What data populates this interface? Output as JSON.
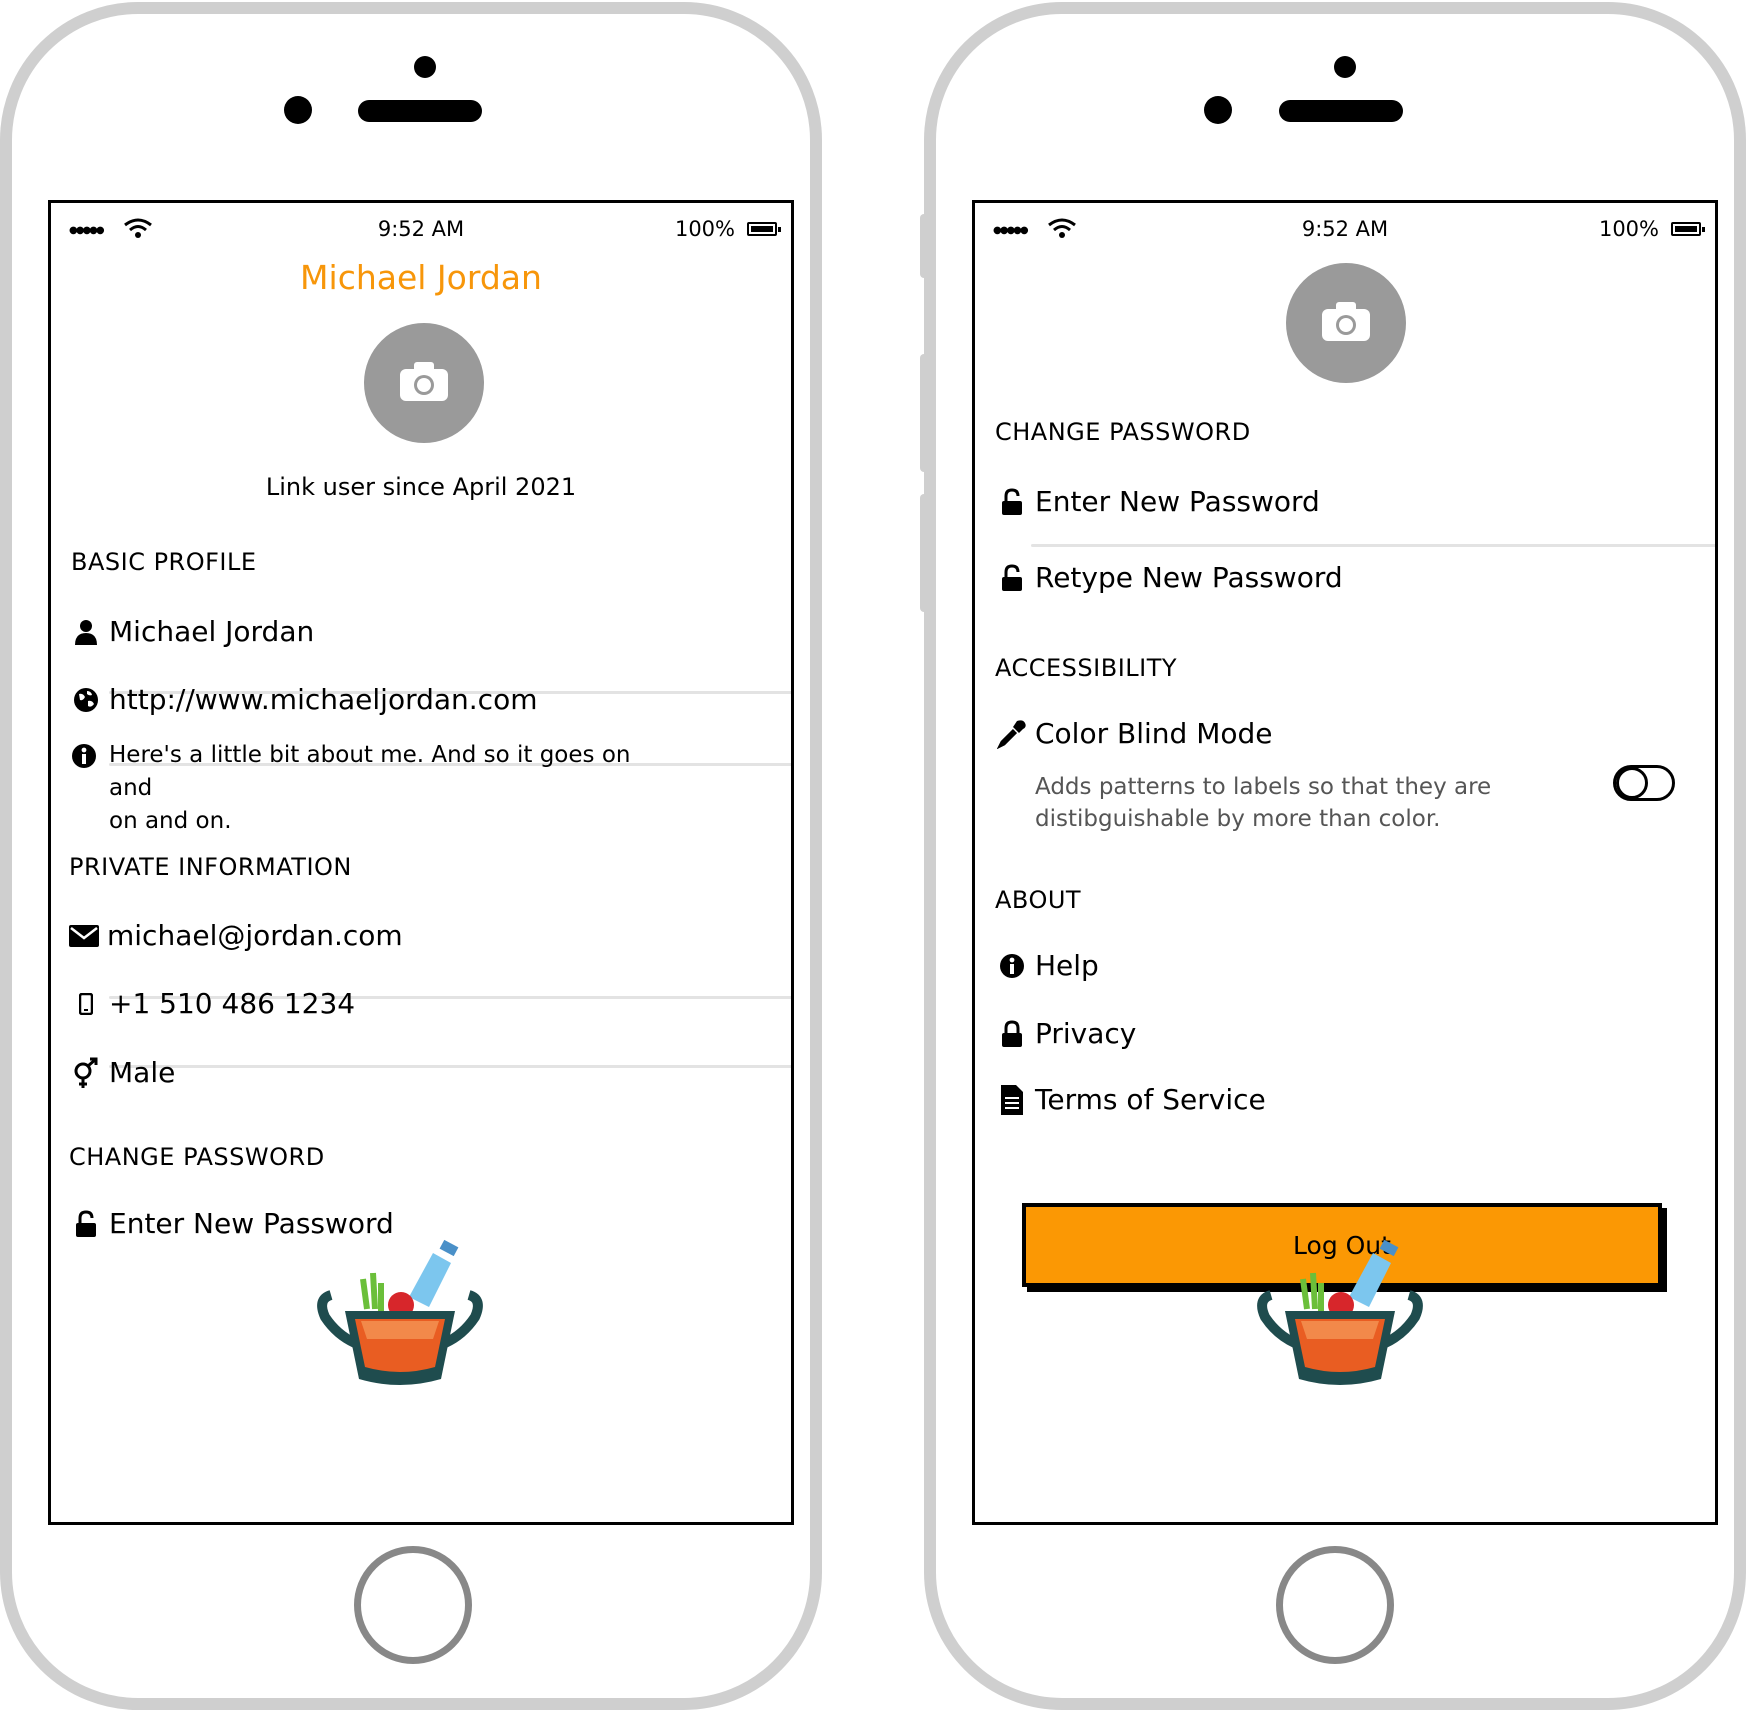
{
  "status": {
    "time": "9:52 AM",
    "battery": "100%"
  },
  "profile": {
    "title": "Michael Jordan",
    "since": "Link user since April 2021",
    "basic_header": "BASIC PROFILE",
    "name": "Michael Jordan",
    "website": "http://www.michaeljordan.com",
    "bio_line1": "Here's a little bit about me. And so it goes on and",
    "bio_line2": "on and on.",
    "private_header": "PRIVATE INFORMATION",
    "email": "michael@jordan.com",
    "phone": "+1 510 486 1234",
    "gender": "Male",
    "password_header": "CHANGE PASSWORD",
    "new_password": "Enter New Password"
  },
  "settings": {
    "password_header": "CHANGE PASSWORD",
    "new_password": "Enter New Password",
    "retype_password": "Retype New Password",
    "accessibility_header": "ACCESSIBILITY",
    "color_blind_label": "Color Blind Mode",
    "color_blind_desc_1": "Adds patterns to labels so that they are",
    "color_blind_desc_2": "distibguishable by more than color.",
    "color_blind_on": false,
    "about_header": "ABOUT",
    "help": "Help",
    "privacy": "Privacy",
    "terms": "Terms of Service",
    "logout": "Log Out"
  },
  "colors": {
    "accent": "#f7960a",
    "button": "#fb9804",
    "avatar": "#9a9a9a",
    "frame": "#cfcfcf"
  },
  "icons": [
    "signal-icon",
    "wifi-icon",
    "battery-icon",
    "camera-icon",
    "user-icon",
    "globe-icon",
    "info-icon",
    "envelope-icon",
    "mobile-icon",
    "gender-icon",
    "unlock-icon",
    "eyedropper-icon",
    "lock-icon",
    "document-icon",
    "basket-logo"
  ]
}
